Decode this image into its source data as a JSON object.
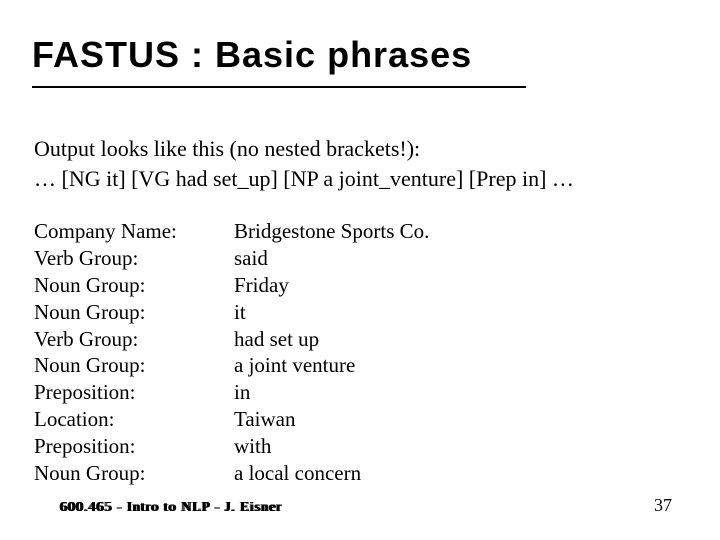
{
  "title": "FASTUS : Basic phrases",
  "title_underline_width": 494,
  "intro": {
    "line1": "Output looks like this (no nested brackets!):",
    "line2": "… [NG it] [VG had set_up] [NP a joint_venture] [Prep in] …"
  },
  "rows": [
    {
      "label": "Company Name:",
      "value": "Bridgestone Sports Co."
    },
    {
      "label": "Verb Group:",
      "value": "said"
    },
    {
      "label": "Noun Group:",
      "value": "Friday"
    },
    {
      "label": "Noun Group:",
      "value": "it"
    },
    {
      "label": "Verb Group:",
      "value": "had set up"
    },
    {
      "label": "Noun Group:",
      "value": "a joint venture"
    },
    {
      "label": "Preposition:",
      "value": "in"
    },
    {
      "label": "Location:",
      "value": "Taiwan"
    },
    {
      "label": "Preposition:",
      "value": "with"
    },
    {
      "label": "Noun Group:",
      "value": "a local concern"
    }
  ],
  "footer": {
    "left": "600.465 - Intro to NLP - J. Eisner",
    "right": "37"
  }
}
